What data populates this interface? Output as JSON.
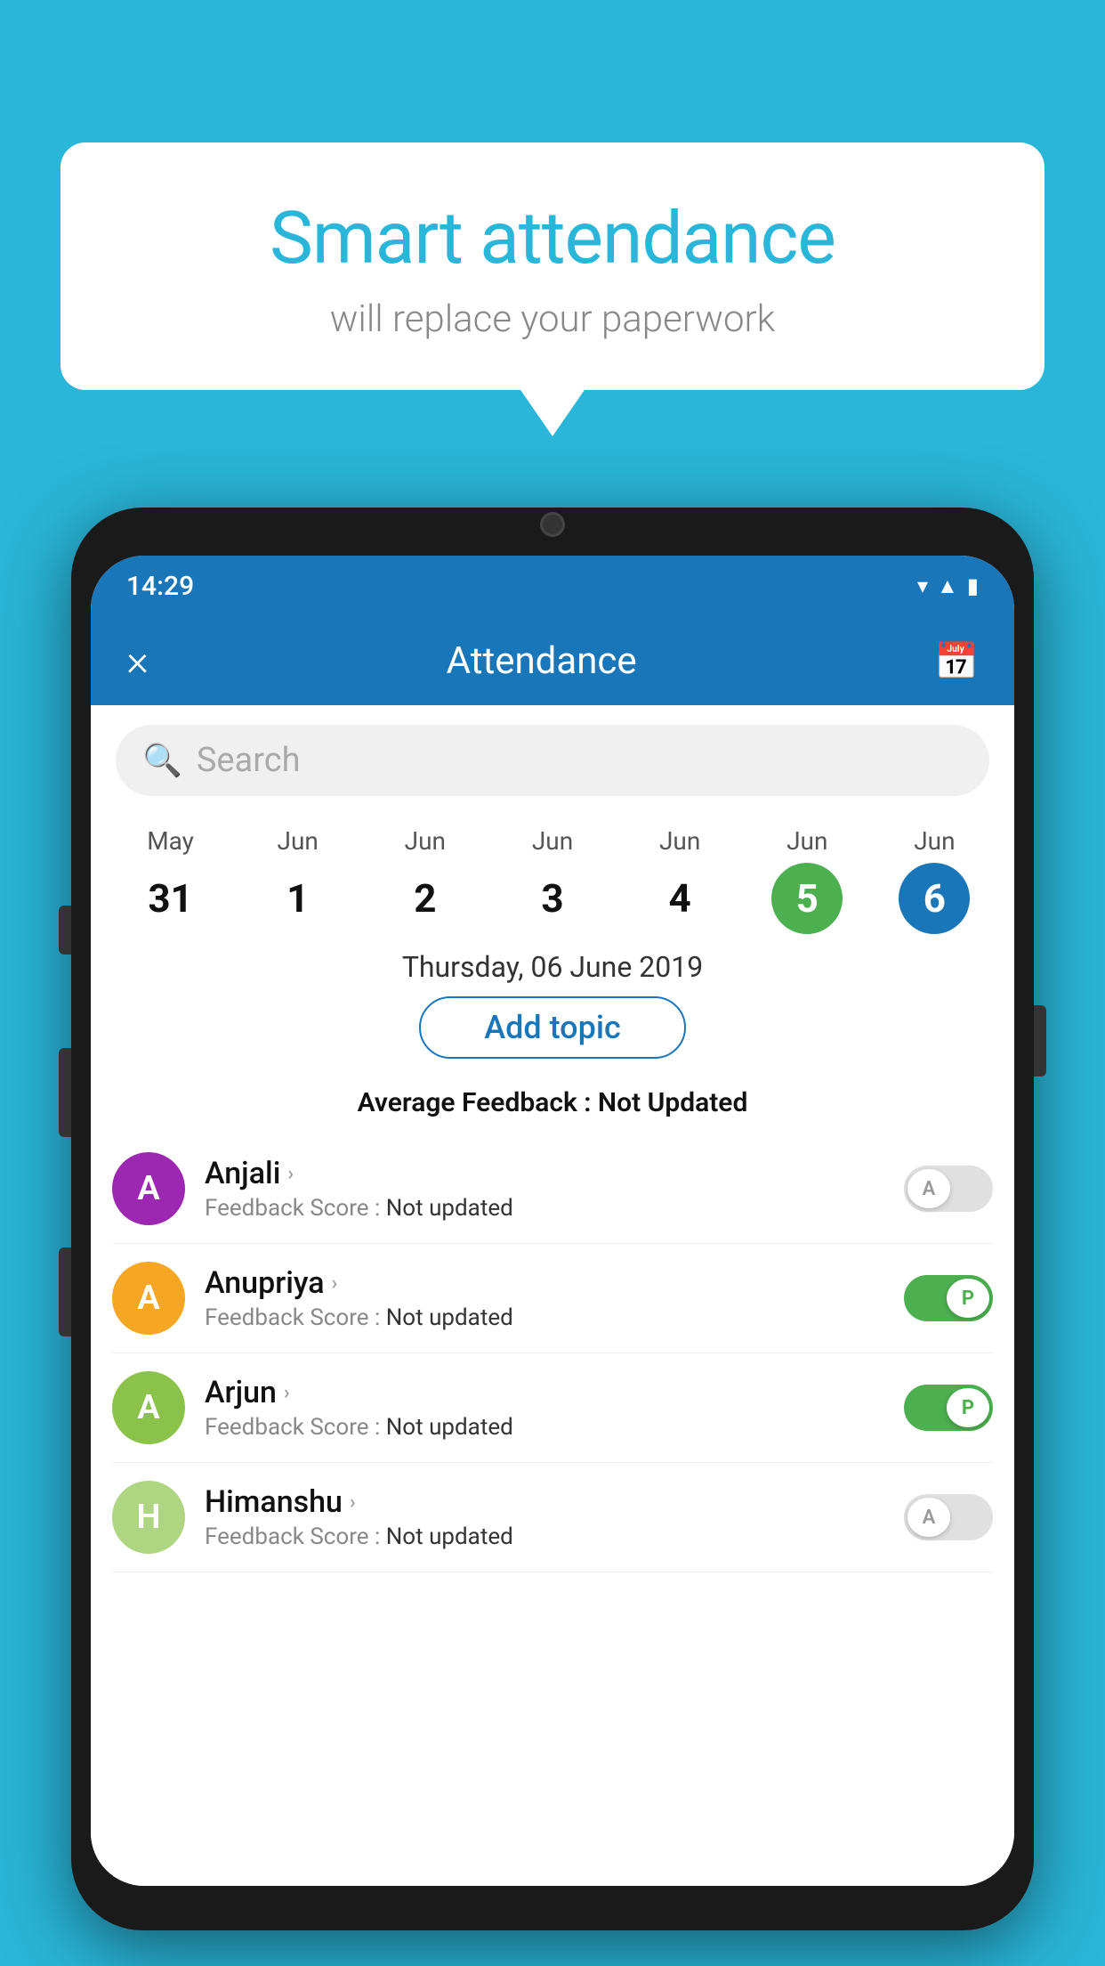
{
  "background": "#29b6d8",
  "bubble": {
    "title": "Smart attendance",
    "subtitle": "will replace your paperwork"
  },
  "phone": {
    "statusBar": {
      "time": "14:29"
    },
    "appBar": {
      "title": "Attendance",
      "closeLabel": "×",
      "calendarIcon": "📅"
    },
    "search": {
      "placeholder": "Search"
    },
    "calendar": {
      "dates": [
        {
          "month": "May",
          "day": "31",
          "state": "normal"
        },
        {
          "month": "Jun",
          "day": "1",
          "state": "normal"
        },
        {
          "month": "Jun",
          "day": "2",
          "state": "normal"
        },
        {
          "month": "Jun",
          "day": "3",
          "state": "normal"
        },
        {
          "month": "Jun",
          "day": "4",
          "state": "normal"
        },
        {
          "month": "Jun",
          "day": "5",
          "state": "today"
        },
        {
          "month": "Jun",
          "day": "6",
          "state": "selected"
        }
      ]
    },
    "selectedDate": "Thursday, 06 June 2019",
    "addTopicLabel": "Add topic",
    "averageFeedback": {
      "label": "Average Feedback : ",
      "value": "Not Updated"
    },
    "students": [
      {
        "name": "Anjali",
        "initial": "A",
        "avatarColor": "#9c27b0",
        "feedback": "Feedback Score : ",
        "feedbackValue": "Not updated",
        "toggleState": "off",
        "toggleLabel": "A"
      },
      {
        "name": "Anupriya",
        "initial": "A",
        "avatarColor": "#f5a623",
        "feedback": "Feedback Score : ",
        "feedbackValue": "Not updated",
        "toggleState": "on",
        "toggleLabel": "P"
      },
      {
        "name": "Arjun",
        "initial": "A",
        "avatarColor": "#8bc34a",
        "feedback": "Feedback Score : ",
        "feedbackValue": "Not updated",
        "toggleState": "on",
        "toggleLabel": "P"
      },
      {
        "name": "Himanshu",
        "initial": "H",
        "avatarColor": "#aed581",
        "feedback": "Feedback Score : ",
        "feedbackValue": "Not updated",
        "toggleState": "off",
        "toggleLabel": "A"
      }
    ]
  }
}
